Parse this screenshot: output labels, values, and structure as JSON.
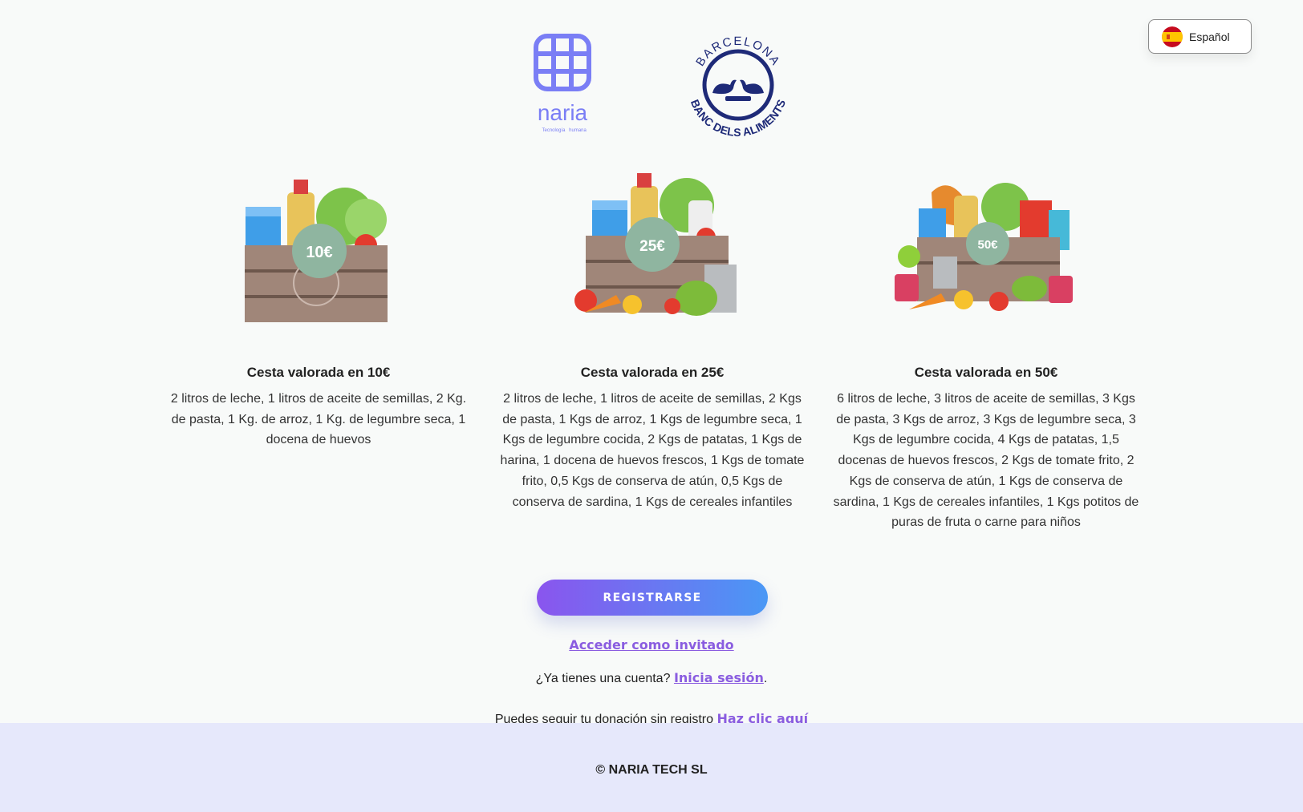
{
  "language_selector": {
    "label": "Español",
    "flag_icon": "spain-flag-icon"
  },
  "logos": {
    "naria_name": "naria",
    "naria_tagline_1": "Tecnología",
    "naria_tagline_2": "humana",
    "banc_top": "BARCELONA",
    "banc_bottom": "BANC DELS ALIMENTS"
  },
  "baskets": [
    {
      "price_badge": "10€",
      "title": "Cesta valorada en 10€",
      "description": "2 litros de leche, 1 litros de aceite de semillas, 2 Kg. de pasta, 1 Kg. de arroz, 1 Kg. de legumbre seca, 1 docena de huevos"
    },
    {
      "price_badge": "25€",
      "title": "Cesta valorada en 25€",
      "description": "2 litros de leche, 1 litros de aceite de semillas, 2 Kgs de pasta, 1 Kgs de arroz, 1 Kgs de legumbre seca, 1 Kgs de legumbre cocida, 2 Kgs de patatas, 1 Kgs de harina, 1 docena de huevos frescos, 1 Kgs de tomate frito, 0,5 Kgs de conserva de atún, 0,5 Kgs de conserva de sardina, 1 Kgs de cereales infantiles"
    },
    {
      "price_badge": "50€",
      "title": "Cesta valorada en 50€",
      "description": "6 litros de leche, 3 litros de aceite de semillas, 3 Kgs de pasta, 3 Kgs de arroz, 3 Kgs de legumbre seca, 3 Kgs de legumbre cocida, 4 Kgs de patatas, 1,5 docenas de huevos frescos, 2 Kgs de tomate frito, 2 Kgs de conserva de atún, 1 Kgs de conserva de sardina, 1 Kgs de cereales infantiles, 1 Kgs potitos de puras de fruta o carne para niños"
    }
  ],
  "actions": {
    "register_label": "REGISTRARSE",
    "guest_label": "Acceder como invitado",
    "has_account_text": "¿Ya tienes una cuenta?",
    "login_label": "Inicia sesión",
    "login_suffix": ".",
    "track_text": "Puedes seguir tu donación sin registro",
    "track_link": "Haz clic aquí"
  },
  "footer": {
    "copyright": "© NARIA TECH SL"
  },
  "colors": {
    "accent_purple": "#8a5de0",
    "gradient_start": "#8a55ee",
    "gradient_end": "#4a98f5",
    "footer_bg": "#e6e8fb",
    "badge_green": "#8fb5a0"
  }
}
